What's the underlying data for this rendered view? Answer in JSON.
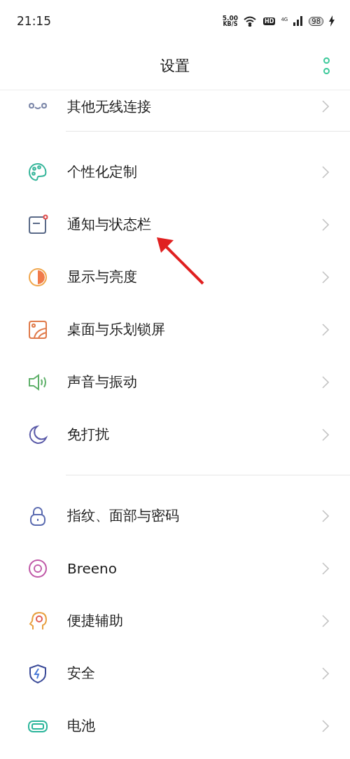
{
  "status_bar": {
    "time": "21:15",
    "speed": "5.00",
    "speed_unit": "KB/S",
    "hd": "HD",
    "network": "4G",
    "battery": "98",
    "charging": true
  },
  "header": {
    "title": "设置"
  },
  "sections": [
    {
      "items": [
        {
          "kind": "wireless",
          "label": "其他无线连接"
        }
      ]
    },
    {
      "items": [
        {
          "kind": "palette",
          "label": "个性化定制"
        },
        {
          "kind": "notification",
          "label": "通知与状态栏"
        },
        {
          "kind": "display",
          "label": "显示与亮度"
        },
        {
          "kind": "wallpaper",
          "label": "桌面与乐划锁屏"
        },
        {
          "kind": "sound",
          "label": "声音与振动"
        },
        {
          "kind": "moon",
          "label": "免打扰"
        }
      ]
    },
    {
      "items": [
        {
          "kind": "lock",
          "label": "指纹、面部与密码"
        },
        {
          "kind": "breeno",
          "label": "Breeno"
        },
        {
          "kind": "accessibility",
          "label": "便捷辅助"
        },
        {
          "kind": "security",
          "label": "安全"
        },
        {
          "kind": "battery",
          "label": "电池"
        }
      ]
    }
  ],
  "annotations": [
    {
      "kind": "arrow"
    }
  ]
}
